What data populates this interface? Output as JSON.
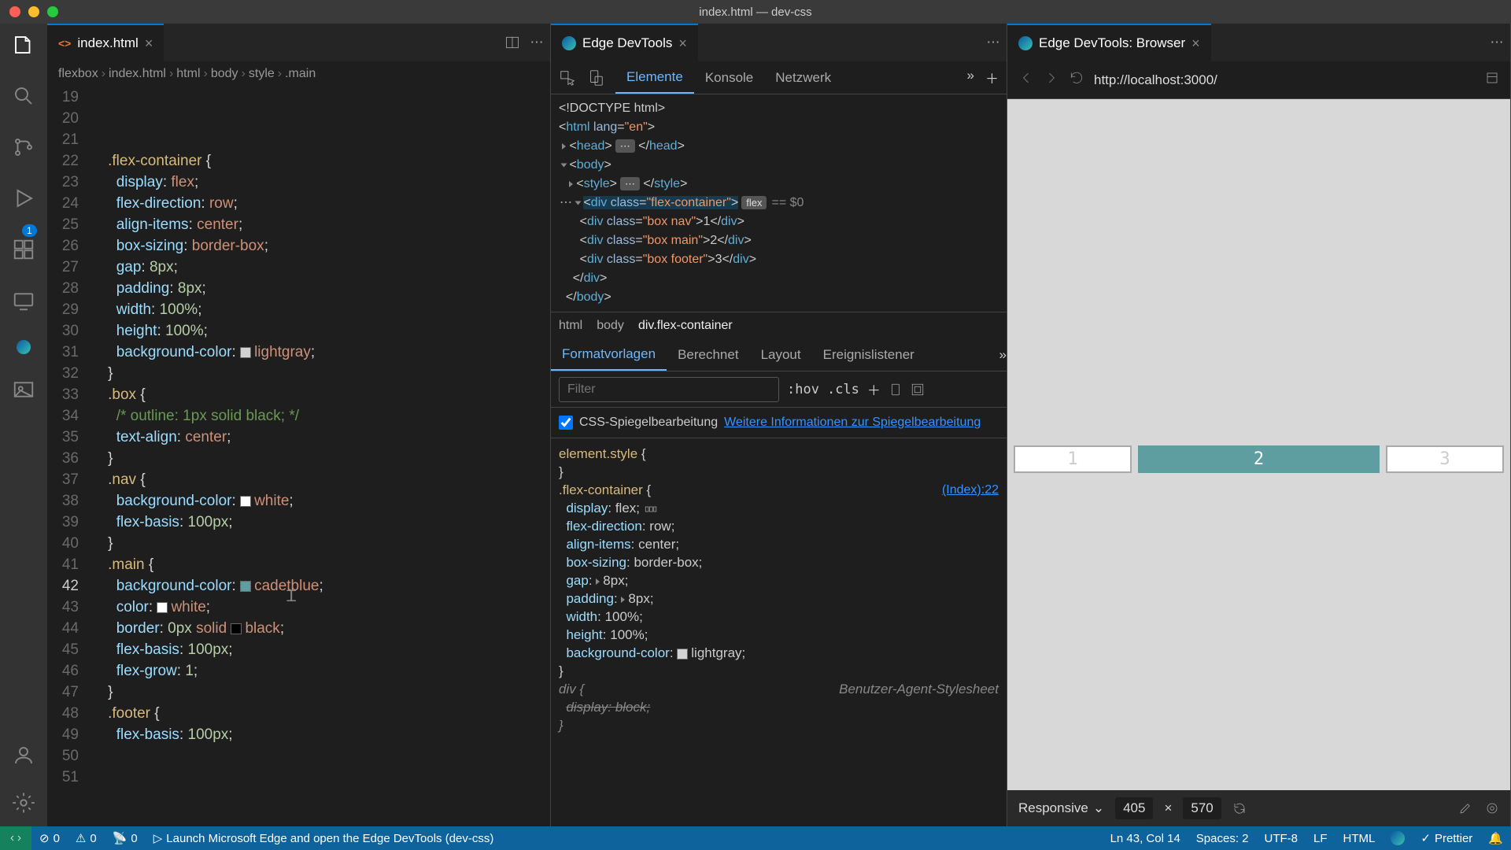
{
  "window": {
    "title": "index.html — dev-css"
  },
  "activity": {
    "badge": "1"
  },
  "editor": {
    "tab": {
      "filename": "index.html"
    },
    "breadcrumb": [
      "flexbox",
      "index.html",
      "html",
      "body",
      "style",
      ".main"
    ],
    "lines": [
      {
        "n": 19,
        "ind": 2,
        "seg": [
          {
            "c": "tk-sel",
            "t": ".flex-container"
          },
          {
            "t": " {"
          }
        ]
      },
      {
        "n": 20,
        "ind": 3,
        "seg": [
          {
            "c": "tk-prop",
            "t": "display"
          },
          {
            "t": ": "
          },
          {
            "c": "tk-val",
            "t": "flex"
          },
          {
            "t": ";"
          }
        ]
      },
      {
        "n": 21,
        "ind": 3,
        "seg": [
          {
            "c": "tk-prop",
            "t": "flex-direction"
          },
          {
            "t": ": "
          },
          {
            "c": "tk-val",
            "t": "row"
          },
          {
            "t": ";"
          }
        ]
      },
      {
        "n": 22,
        "ind": 3,
        "seg": [
          {
            "c": "tk-prop",
            "t": "align-items"
          },
          {
            "t": ": "
          },
          {
            "c": "tk-val",
            "t": "center"
          },
          {
            "t": ";"
          }
        ]
      },
      {
        "n": 23,
        "ind": 3,
        "seg": [
          {
            "c": "tk-prop",
            "t": "box-sizing"
          },
          {
            "t": ": "
          },
          {
            "c": "tk-val",
            "t": "border-box"
          },
          {
            "t": ";"
          }
        ]
      },
      {
        "n": 24,
        "ind": 3,
        "seg": [
          {
            "c": "tk-prop",
            "t": "gap"
          },
          {
            "t": ": "
          },
          {
            "c": "tk-num",
            "t": "8px"
          },
          {
            "t": ";"
          }
        ]
      },
      {
        "n": 25,
        "ind": 3,
        "seg": [
          {
            "c": "tk-prop",
            "t": "padding"
          },
          {
            "t": ": "
          },
          {
            "c": "tk-num",
            "t": "8px"
          },
          {
            "t": ";"
          }
        ]
      },
      {
        "n": 26,
        "ind": 3,
        "seg": [
          {
            "c": "tk-prop",
            "t": "width"
          },
          {
            "t": ": "
          },
          {
            "c": "tk-num",
            "t": "100%"
          },
          {
            "t": ";"
          }
        ]
      },
      {
        "n": 27,
        "ind": 3,
        "seg": [
          {
            "c": "tk-prop",
            "t": "height"
          },
          {
            "t": ": "
          },
          {
            "c": "tk-num",
            "t": "100%"
          },
          {
            "t": ";"
          }
        ]
      },
      {
        "n": 28,
        "ind": 3,
        "seg": [
          {
            "c": "tk-prop",
            "t": "background-color"
          },
          {
            "t": ": "
          },
          {
            "sw": "#d3d3d3"
          },
          {
            "c": "tk-val",
            "t": "lightgray"
          },
          {
            "t": ";"
          }
        ]
      },
      {
        "n": 29,
        "ind": 2,
        "seg": [
          {
            "t": "}"
          }
        ]
      },
      {
        "n": 30,
        "ind": 0,
        "seg": [
          {
            "t": ""
          }
        ]
      },
      {
        "n": 31,
        "ind": 2,
        "seg": [
          {
            "c": "tk-sel",
            "t": ".box"
          },
          {
            "t": " {"
          }
        ]
      },
      {
        "n": 32,
        "ind": 3,
        "seg": [
          {
            "c": "tk-com",
            "t": "/* outline: 1px solid black; */"
          }
        ]
      },
      {
        "n": 33,
        "ind": 3,
        "seg": [
          {
            "c": "tk-prop",
            "t": "text-align"
          },
          {
            "t": ": "
          },
          {
            "c": "tk-val",
            "t": "center"
          },
          {
            "t": ";"
          }
        ]
      },
      {
        "n": 34,
        "ind": 2,
        "seg": [
          {
            "t": "}"
          }
        ]
      },
      {
        "n": 35,
        "ind": 0,
        "seg": [
          {
            "t": ""
          }
        ]
      },
      {
        "n": 36,
        "ind": 2,
        "seg": [
          {
            "c": "tk-sel",
            "t": ".nav"
          },
          {
            "t": " {"
          }
        ]
      },
      {
        "n": 37,
        "ind": 3,
        "seg": [
          {
            "c": "tk-prop",
            "t": "background-color"
          },
          {
            "t": ": "
          },
          {
            "sw": "#fff"
          },
          {
            "c": "tk-val",
            "t": "white"
          },
          {
            "t": ";"
          }
        ]
      },
      {
        "n": 38,
        "ind": 3,
        "seg": [
          {
            "c": "tk-prop",
            "t": "flex-basis"
          },
          {
            "t": ": "
          },
          {
            "c": "tk-num",
            "t": "100px"
          },
          {
            "t": ";"
          }
        ]
      },
      {
        "n": 39,
        "ind": 0,
        "seg": [
          {
            "t": ""
          }
        ]
      },
      {
        "n": 40,
        "ind": 2,
        "seg": [
          {
            "t": "}"
          }
        ]
      },
      {
        "n": 41,
        "ind": 0,
        "seg": [
          {
            "t": ""
          }
        ]
      },
      {
        "n": 42,
        "ind": 2,
        "cur": true,
        "seg": [
          {
            "c": "tk-sel",
            "t": ".main"
          },
          {
            "t": " {"
          }
        ]
      },
      {
        "n": 43,
        "ind": 3,
        "seg": [
          {
            "c": "tk-prop",
            "t": "background-color"
          },
          {
            "t": ": "
          },
          {
            "sw": "#5f9ea0"
          },
          {
            "c": "tk-val",
            "t": "cadetblue"
          },
          {
            "t": ";"
          }
        ]
      },
      {
        "n": 44,
        "ind": 3,
        "seg": [
          {
            "c": "tk-prop",
            "t": "color"
          },
          {
            "t": ": "
          },
          {
            "sw": "#fff"
          },
          {
            "c": "tk-val",
            "t": "white"
          },
          {
            "t": ";"
          }
        ]
      },
      {
        "n": 45,
        "ind": 3,
        "seg": [
          {
            "c": "tk-prop",
            "t": "border"
          },
          {
            "t": ": "
          },
          {
            "c": "tk-num",
            "t": "0px"
          },
          {
            "t": " "
          },
          {
            "c": "tk-val",
            "t": "solid"
          },
          {
            "t": " "
          },
          {
            "sw": "#000"
          },
          {
            "c": "tk-val",
            "t": "black"
          },
          {
            "t": ";"
          }
        ]
      },
      {
        "n": 46,
        "ind": 3,
        "seg": [
          {
            "c": "tk-prop",
            "t": "flex-basis"
          },
          {
            "t": ": "
          },
          {
            "c": "tk-num",
            "t": "100px"
          },
          {
            "t": ";"
          }
        ]
      },
      {
        "n": 47,
        "ind": 3,
        "seg": [
          {
            "c": "tk-prop",
            "t": "flex-grow"
          },
          {
            "t": ": "
          },
          {
            "c": "tk-num",
            "t": "1"
          },
          {
            "t": ";"
          }
        ]
      },
      {
        "n": 48,
        "ind": 2,
        "seg": [
          {
            "t": "}"
          }
        ]
      },
      {
        "n": 49,
        "ind": 0,
        "seg": [
          {
            "t": ""
          }
        ]
      },
      {
        "n": 50,
        "ind": 2,
        "seg": [
          {
            "c": "tk-sel",
            "t": ".footer"
          },
          {
            "t": " {"
          }
        ]
      },
      {
        "n": 51,
        "ind": 3,
        "seg": [
          {
            "c": "tk-prop",
            "t": "flex-basis"
          },
          {
            "t": ": "
          },
          {
            "c": "tk-num",
            "t": "100px"
          },
          {
            "t": ";"
          }
        ]
      }
    ]
  },
  "devtools": {
    "tab_title": "Edge DevTools",
    "tabs": [
      "Elemente",
      "Konsole",
      "Netzwerk"
    ],
    "crumb": [
      "html",
      "body",
      "div.flex-container"
    ],
    "styles_tabs": [
      "Formatvorlagen",
      "Berechnet",
      "Layout",
      "Ereignislistener"
    ],
    "filter_placeholder": "Filter",
    "hov": ":hov",
    "cls": ".cls",
    "mirror_label": "CSS-Spiegelbearbeitung",
    "mirror_link": "Weitere Informationen zur Spiegelbearbeitung",
    "rule_src": "(Index):22",
    "ua_label": "Benutzer-Agent-Stylesheet"
  },
  "browser": {
    "tab_title": "Edge DevTools: Browser",
    "url": "http://localhost:3000/",
    "boxes": [
      "1",
      "2",
      "3"
    ],
    "responsive_label": "Responsive",
    "width": "405",
    "height": "570"
  },
  "status": {
    "errors": "0",
    "warnings": "0",
    "ports": "0",
    "launch": "Launch Microsoft Edge and open the Edge DevTools (dev-css)",
    "cursor": "Ln 43, Col 14",
    "spaces": "Spaces: 2",
    "enc": "UTF-8",
    "eol": "LF",
    "lang": "HTML",
    "prettier": "Prettier"
  }
}
